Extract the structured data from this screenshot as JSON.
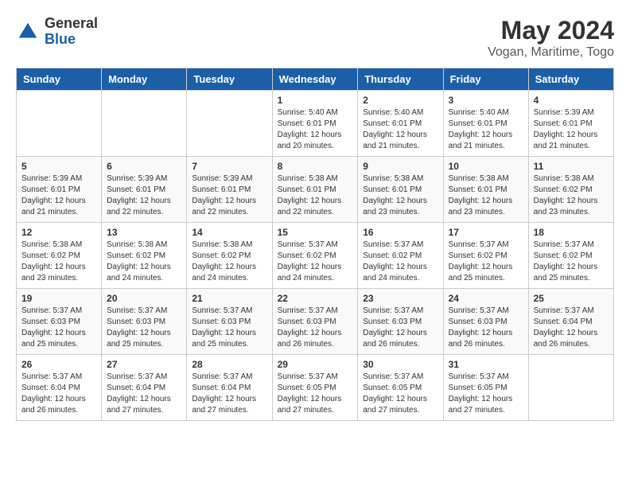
{
  "header": {
    "logo_general": "General",
    "logo_blue": "Blue",
    "title": "May 2024",
    "subtitle": "Vogan, Maritime, Togo"
  },
  "days_of_week": [
    "Sunday",
    "Monday",
    "Tuesday",
    "Wednesday",
    "Thursday",
    "Friday",
    "Saturday"
  ],
  "weeks": [
    [
      {
        "day": "",
        "info": ""
      },
      {
        "day": "",
        "info": ""
      },
      {
        "day": "",
        "info": ""
      },
      {
        "day": "1",
        "info": "Sunrise: 5:40 AM\nSunset: 6:01 PM\nDaylight: 12 hours and 20 minutes."
      },
      {
        "day": "2",
        "info": "Sunrise: 5:40 AM\nSunset: 6:01 PM\nDaylight: 12 hours and 21 minutes."
      },
      {
        "day": "3",
        "info": "Sunrise: 5:40 AM\nSunset: 6:01 PM\nDaylight: 12 hours and 21 minutes."
      },
      {
        "day": "4",
        "info": "Sunrise: 5:39 AM\nSunset: 6:01 PM\nDaylight: 12 hours and 21 minutes."
      }
    ],
    [
      {
        "day": "5",
        "info": "Sunrise: 5:39 AM\nSunset: 6:01 PM\nDaylight: 12 hours and 21 minutes."
      },
      {
        "day": "6",
        "info": "Sunrise: 5:39 AM\nSunset: 6:01 PM\nDaylight: 12 hours and 22 minutes."
      },
      {
        "day": "7",
        "info": "Sunrise: 5:39 AM\nSunset: 6:01 PM\nDaylight: 12 hours and 22 minutes."
      },
      {
        "day": "8",
        "info": "Sunrise: 5:38 AM\nSunset: 6:01 PM\nDaylight: 12 hours and 22 minutes."
      },
      {
        "day": "9",
        "info": "Sunrise: 5:38 AM\nSunset: 6:01 PM\nDaylight: 12 hours and 23 minutes."
      },
      {
        "day": "10",
        "info": "Sunrise: 5:38 AM\nSunset: 6:01 PM\nDaylight: 12 hours and 23 minutes."
      },
      {
        "day": "11",
        "info": "Sunrise: 5:38 AM\nSunset: 6:02 PM\nDaylight: 12 hours and 23 minutes."
      }
    ],
    [
      {
        "day": "12",
        "info": "Sunrise: 5:38 AM\nSunset: 6:02 PM\nDaylight: 12 hours and 23 minutes."
      },
      {
        "day": "13",
        "info": "Sunrise: 5:38 AM\nSunset: 6:02 PM\nDaylight: 12 hours and 24 minutes."
      },
      {
        "day": "14",
        "info": "Sunrise: 5:38 AM\nSunset: 6:02 PM\nDaylight: 12 hours and 24 minutes."
      },
      {
        "day": "15",
        "info": "Sunrise: 5:37 AM\nSunset: 6:02 PM\nDaylight: 12 hours and 24 minutes."
      },
      {
        "day": "16",
        "info": "Sunrise: 5:37 AM\nSunset: 6:02 PM\nDaylight: 12 hours and 24 minutes."
      },
      {
        "day": "17",
        "info": "Sunrise: 5:37 AM\nSunset: 6:02 PM\nDaylight: 12 hours and 25 minutes."
      },
      {
        "day": "18",
        "info": "Sunrise: 5:37 AM\nSunset: 6:02 PM\nDaylight: 12 hours and 25 minutes."
      }
    ],
    [
      {
        "day": "19",
        "info": "Sunrise: 5:37 AM\nSunset: 6:03 PM\nDaylight: 12 hours and 25 minutes."
      },
      {
        "day": "20",
        "info": "Sunrise: 5:37 AM\nSunset: 6:03 PM\nDaylight: 12 hours and 25 minutes."
      },
      {
        "day": "21",
        "info": "Sunrise: 5:37 AM\nSunset: 6:03 PM\nDaylight: 12 hours and 25 minutes."
      },
      {
        "day": "22",
        "info": "Sunrise: 5:37 AM\nSunset: 6:03 PM\nDaylight: 12 hours and 26 minutes."
      },
      {
        "day": "23",
        "info": "Sunrise: 5:37 AM\nSunset: 6:03 PM\nDaylight: 12 hours and 26 minutes."
      },
      {
        "day": "24",
        "info": "Sunrise: 5:37 AM\nSunset: 6:03 PM\nDaylight: 12 hours and 26 minutes."
      },
      {
        "day": "25",
        "info": "Sunrise: 5:37 AM\nSunset: 6:04 PM\nDaylight: 12 hours and 26 minutes."
      }
    ],
    [
      {
        "day": "26",
        "info": "Sunrise: 5:37 AM\nSunset: 6:04 PM\nDaylight: 12 hours and 26 minutes."
      },
      {
        "day": "27",
        "info": "Sunrise: 5:37 AM\nSunset: 6:04 PM\nDaylight: 12 hours and 27 minutes."
      },
      {
        "day": "28",
        "info": "Sunrise: 5:37 AM\nSunset: 6:04 PM\nDaylight: 12 hours and 27 minutes."
      },
      {
        "day": "29",
        "info": "Sunrise: 5:37 AM\nSunset: 6:05 PM\nDaylight: 12 hours and 27 minutes."
      },
      {
        "day": "30",
        "info": "Sunrise: 5:37 AM\nSunset: 6:05 PM\nDaylight: 12 hours and 27 minutes."
      },
      {
        "day": "31",
        "info": "Sunrise: 5:37 AM\nSunset: 6:05 PM\nDaylight: 12 hours and 27 minutes."
      },
      {
        "day": "",
        "info": ""
      }
    ]
  ]
}
